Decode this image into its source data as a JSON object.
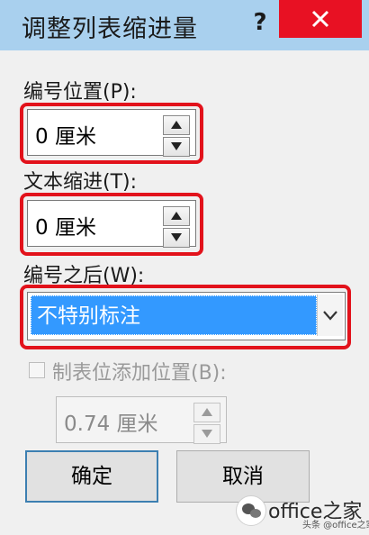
{
  "dialog": {
    "title": "调整列表缩进量",
    "help_label": "?"
  },
  "number_position": {
    "label": "编号位置(P):",
    "value": "0 厘米"
  },
  "text_indent": {
    "label": "文本缩进(T):",
    "value": "0 厘米"
  },
  "follow_number_with": {
    "label": "编号之后(W):",
    "selected": "不特别标注"
  },
  "add_tab_stop": {
    "label": "制表位添加位置(B):",
    "checked": false,
    "value": "0.74 厘米"
  },
  "buttons": {
    "ok": "确定",
    "cancel": "取消"
  },
  "watermark": {
    "text": "office之家",
    "sub": "头条 @office之家"
  },
  "colors": {
    "titlebar": "#a9d0ee",
    "close": "#e81123",
    "highlight": "#e2121b",
    "selection": "#3399ff"
  }
}
